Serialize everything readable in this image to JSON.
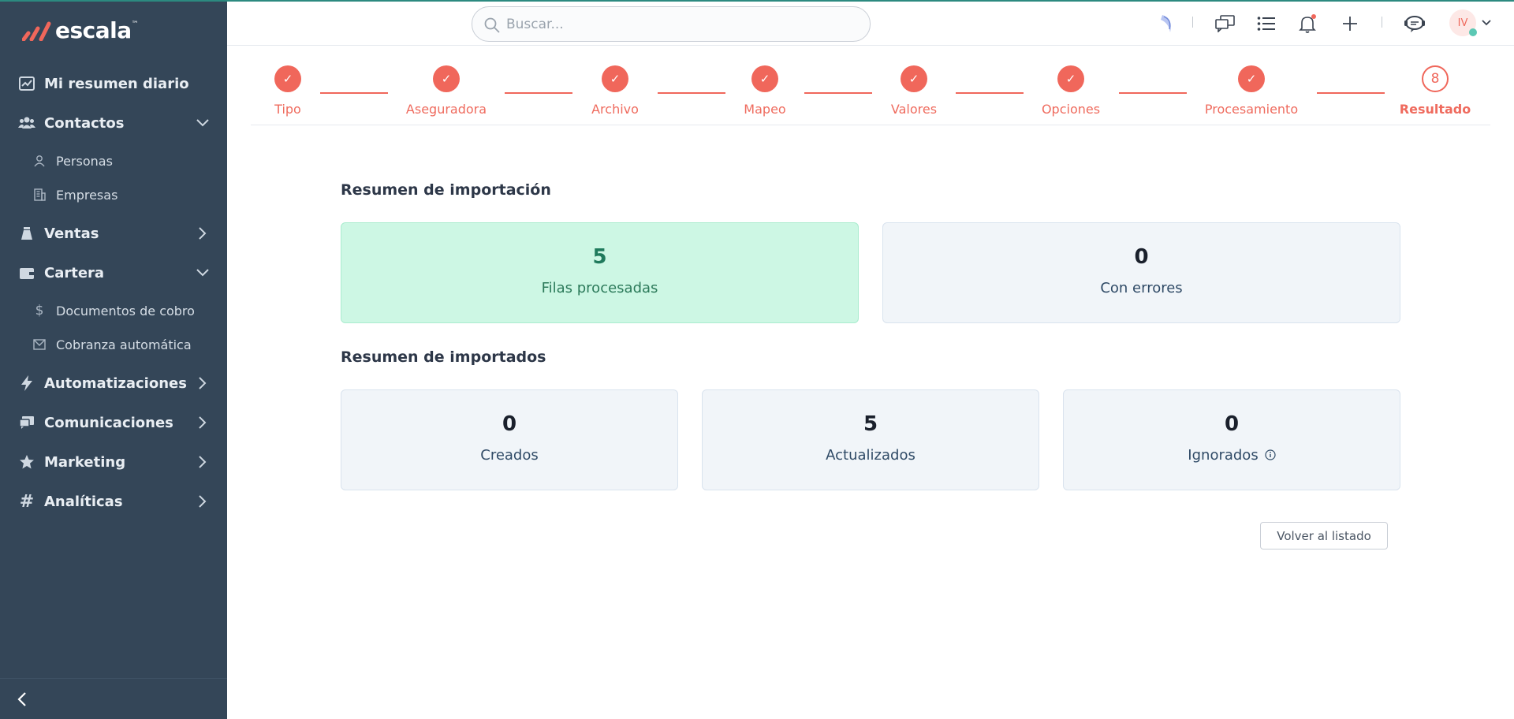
{
  "brand": {
    "name": "escala",
    "tm": "™"
  },
  "sidebar": {
    "items": [
      {
        "label": "Mi resumen diario"
      },
      {
        "label": "Contactos"
      },
      {
        "label": "Personas"
      },
      {
        "label": "Empresas"
      },
      {
        "label": "Ventas"
      },
      {
        "label": "Cartera"
      },
      {
        "label": "Documentos de cobro"
      },
      {
        "label": "Cobranza automática"
      },
      {
        "label": "Automatizaciones"
      },
      {
        "label": "Comunicaciones"
      },
      {
        "label": "Marketing"
      },
      {
        "label": "Analíticas"
      }
    ]
  },
  "header": {
    "search_placeholder": "Buscar...",
    "user_initials": "IV"
  },
  "stepper": {
    "steps": [
      {
        "label": "Tipo",
        "status": "done",
        "mark": "✓"
      },
      {
        "label": "Aseguradora",
        "status": "done",
        "mark": "✓"
      },
      {
        "label": "Archivo",
        "status": "done",
        "mark": "✓"
      },
      {
        "label": "Mapeo",
        "status": "done",
        "mark": "✓"
      },
      {
        "label": "Valores",
        "status": "done",
        "mark": "✓"
      },
      {
        "label": "Opciones",
        "status": "done",
        "mark": "✓"
      },
      {
        "label": "Procesamiento",
        "status": "done",
        "mark": "✓"
      },
      {
        "label": "Resultado",
        "status": "current",
        "mark": "8"
      }
    ]
  },
  "import_summary": {
    "title": "Resumen de importación",
    "processed": {
      "value": "5",
      "label": "Filas procesadas"
    },
    "errors": {
      "value": "0",
      "label": "Con errores"
    }
  },
  "imported_summary": {
    "title": "Resumen de importados",
    "created": {
      "value": "0",
      "label": "Creados"
    },
    "updated": {
      "value": "5",
      "label": "Actualizados"
    },
    "ignored": {
      "value": "0",
      "label": "Ignorados"
    }
  },
  "actions": {
    "back_label": "Volver al listado"
  },
  "colors": {
    "accent": "#f0675b",
    "sidebar": "#344658",
    "success_bg": "#cdf7e4",
    "success_text": "#1f7a5c"
  }
}
